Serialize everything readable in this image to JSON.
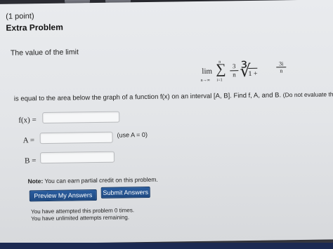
{
  "problem": {
    "points": "(1 point)",
    "title": "Extra Problem",
    "prompt": "The value of the limit",
    "formula": {
      "lim": "lim",
      "lim_sub": "n→∞",
      "sum_upper": "n",
      "sum_symbol": "∑",
      "sum_lower": "i=1",
      "coef_num": "3",
      "coef_den": "n",
      "radical_index": "3",
      "radicand": "1 +",
      "frac_num": "3i",
      "frac_den": "n"
    },
    "statement": "is equal to the area below the graph of a function f(x) on an interval [A, B]. Find f, A, and B.",
    "statement_note": "(Do not evaluate the limit.)"
  },
  "fields": {
    "f_label": "f(x) =",
    "a_label": "A =",
    "b_label": "B =",
    "f_value": "",
    "a_value": "",
    "b_value": "",
    "a_note": "(use A = 0)"
  },
  "credit": {
    "label": "Note:",
    "text": "You can earn partial credit on this problem."
  },
  "buttons": {
    "preview": "Preview My Answers",
    "submit": "Submit Answers"
  },
  "status": {
    "attempts": "You have attempted this problem 0 times.",
    "remaining": "You have unlimited attempts remaining."
  },
  "colors": {
    "button": "#2a5d9f",
    "page": "#e6e8eb",
    "background": "#3c3d44"
  }
}
